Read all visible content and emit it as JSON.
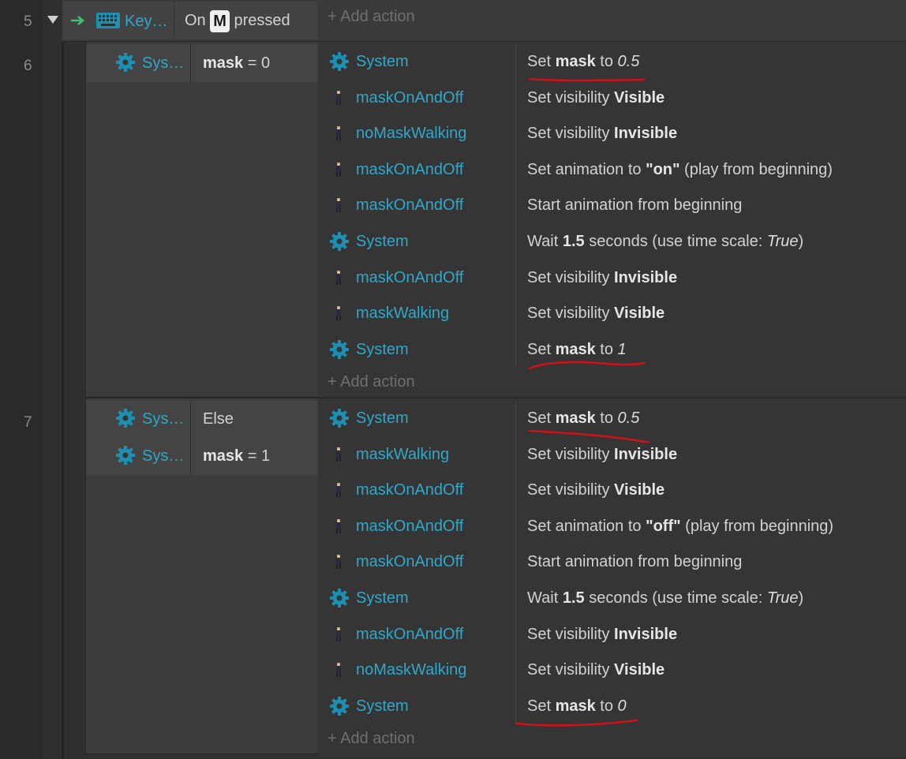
{
  "events": [
    {
      "line": "5",
      "condition": {
        "object": "Key…",
        "text_before": "On",
        "key": "M",
        "text_after": "pressed",
        "add_action": "+ Add action"
      }
    },
    {
      "line": "6",
      "conditions": [
        {
          "object": "Sys…",
          "var": "mask",
          "op": "=",
          "value": "0"
        }
      ],
      "actions": [
        {
          "object": "System",
          "icon": "gear-icon",
          "pre": "Set ",
          "bold": "mask",
          "mid": " to ",
          "italic": "0.5",
          "post": ""
        },
        {
          "object": "maskOnAndOff",
          "icon": "sprite-icon",
          "pre": "Set visibility ",
          "bold": "Visible",
          "mid": "",
          "italic": "",
          "post": ""
        },
        {
          "object": "noMaskWalking",
          "icon": "sprite-icon",
          "pre": "Set visibility ",
          "bold": "Invisible",
          "mid": "",
          "italic": "",
          "post": ""
        },
        {
          "object": "maskOnAndOff",
          "icon": "sprite-icon",
          "pre": "Set animation to ",
          "bold": "\"on\"",
          "mid": "",
          "italic": "",
          "post": " (play from beginning)"
        },
        {
          "object": "maskOnAndOff",
          "icon": "sprite-icon",
          "pre": "Start animation from beginning",
          "bold": "",
          "mid": "",
          "italic": "",
          "post": ""
        },
        {
          "object": "System",
          "icon": "gear-icon",
          "pre": "Wait ",
          "bold": "1.5",
          "mid": " seconds (use time scale: ",
          "italic": "True",
          "post": ")"
        },
        {
          "object": "maskOnAndOff",
          "icon": "sprite-icon",
          "pre": "Set visibility ",
          "bold": "Invisible",
          "mid": "",
          "italic": "",
          "post": ""
        },
        {
          "object": "maskWalking",
          "icon": "sprite-icon",
          "pre": "Set visibility ",
          "bold": "Visible",
          "mid": "",
          "italic": "",
          "post": ""
        },
        {
          "object": "System",
          "icon": "gear-icon",
          "pre": "Set ",
          "bold": "mask",
          "mid": " to ",
          "italic": "1",
          "post": ""
        }
      ],
      "add_action": "+ Add action"
    },
    {
      "line": "7",
      "conditions": [
        {
          "object": "Sys…",
          "var": "Else",
          "op": "",
          "value": ""
        },
        {
          "object": "Sys…",
          "var": "mask",
          "op": "=",
          "value": "1"
        }
      ],
      "actions": [
        {
          "object": "System",
          "icon": "gear-icon",
          "pre": "Set ",
          "bold": "mask",
          "mid": " to ",
          "italic": "0.5",
          "post": ""
        },
        {
          "object": "maskWalking",
          "icon": "sprite-icon",
          "pre": "Set visibility ",
          "bold": "Invisible",
          "mid": "",
          "italic": "",
          "post": ""
        },
        {
          "object": "maskOnAndOff",
          "icon": "sprite-icon",
          "pre": "Set visibility ",
          "bold": "Visible",
          "mid": "",
          "italic": "",
          "post": ""
        },
        {
          "object": "maskOnAndOff",
          "icon": "sprite-icon",
          "pre": "Set animation to ",
          "bold": "\"off\"",
          "mid": "",
          "italic": "",
          "post": " (play from beginning)"
        },
        {
          "object": "maskOnAndOff",
          "icon": "sprite-icon",
          "pre": "Start animation from beginning",
          "bold": "",
          "mid": "",
          "italic": "",
          "post": ""
        },
        {
          "object": "System",
          "icon": "gear-icon",
          "pre": "Wait ",
          "bold": "1.5",
          "mid": " seconds (use time scale: ",
          "italic": "True",
          "post": ")"
        },
        {
          "object": "maskOnAndOff",
          "icon": "sprite-icon",
          "pre": "Set visibility ",
          "bold": "Invisible",
          "mid": "",
          "italic": "",
          "post": ""
        },
        {
          "object": "noMaskWalking",
          "icon": "sprite-icon",
          "pre": "Set visibility ",
          "bold": "Visible",
          "mid": "",
          "italic": "",
          "post": ""
        },
        {
          "object": "System",
          "icon": "gear-icon",
          "pre": "Set ",
          "bold": "mask",
          "mid": " to ",
          "italic": "0",
          "post": ""
        }
      ],
      "add_action": "+ Add action"
    }
  ],
  "colors": {
    "object_link": "#2fa8c9",
    "gear": "#1e8fb0",
    "trigger_arrow": "#3ec26b",
    "annotation": "#d0101a"
  }
}
